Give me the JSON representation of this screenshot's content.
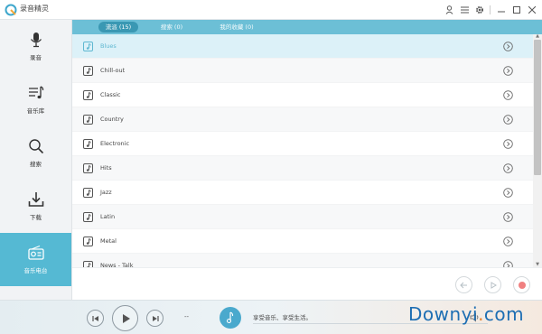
{
  "app": {
    "title": "录音精灵",
    "icons": [
      "user-icon",
      "menu-list-icon",
      "gear-icon",
      "minimize-icon",
      "maximize-icon",
      "close-icon"
    ]
  },
  "sidebar": {
    "items": [
      {
        "label": "录音",
        "icon": "microphone-icon",
        "active": false
      },
      {
        "label": "音乐库",
        "icon": "music-library-icon",
        "active": false
      },
      {
        "label": "搜索",
        "icon": "search-icon",
        "active": false
      },
      {
        "label": "下载",
        "icon": "download-icon",
        "active": false
      },
      {
        "label": "音乐电台",
        "icon": "radio-icon",
        "active": true
      }
    ]
  },
  "tabs": [
    {
      "label": "流派 (15)",
      "active": true
    },
    {
      "label": "搜索 (0)",
      "active": false
    },
    {
      "label": "我的收藏 (0)",
      "active": false
    }
  ],
  "genres": [
    {
      "label": "Blues",
      "selected": true
    },
    {
      "label": "Chill-out",
      "selected": false
    },
    {
      "label": "Classic",
      "selected": false
    },
    {
      "label": "Country",
      "selected": false
    },
    {
      "label": "Electronic",
      "selected": false
    },
    {
      "label": "Hits",
      "selected": false
    },
    {
      "label": "Jazz",
      "selected": false
    },
    {
      "label": "Latin",
      "selected": false
    },
    {
      "label": "Metal",
      "selected": false
    },
    {
      "label": "News - Talk",
      "selected": false
    }
  ],
  "player": {
    "dash": "--",
    "slogan": "享受音乐、享受生活。"
  },
  "colors": {
    "accent": "#55b9d3",
    "tab_bar": "#6cbfd6",
    "tab_active": "#3a98b3",
    "selected_row": "#dcf1f8",
    "record": "#f08080"
  },
  "watermark": {
    "prefix": "Downyi",
    "dot": ".",
    "suffix": "com"
  }
}
